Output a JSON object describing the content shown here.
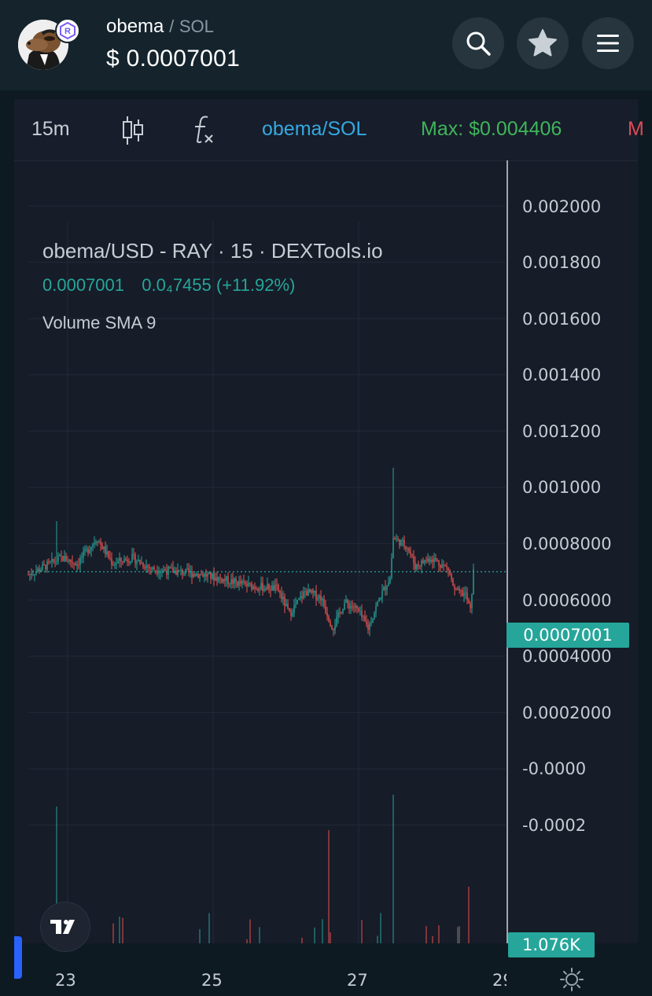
{
  "header": {
    "token_name": "obema",
    "separator": "/",
    "quote": "SOL",
    "price": "$ 0.0007001",
    "badge_letter": "R",
    "icons": [
      "search-icon",
      "star-icon",
      "menu-icon"
    ]
  },
  "toolbar": {
    "interval": "15m",
    "pair": "obema/SOL",
    "max": "Max: $0.004406",
    "cut": "M"
  },
  "chart_data": {
    "type": "candlestick",
    "title": "obema/USD - RAY · 15 · DEXTools.io",
    "last_value": "0.0007001",
    "change_value": "0.0₄7455",
    "change_pct": "(+11.92%)",
    "indicator": "Volume SMA 9",
    "y_ticks": [
      "0.002000",
      "0.001800",
      "0.001600",
      "0.001400",
      "0.001200",
      "0.001000",
      "0.0008000",
      "0.0006000",
      "0.0004000",
      "0.0002000",
      "-0.0000",
      "-0.0002"
    ],
    "x_ticks": [
      "23",
      "25",
      "27",
      "29"
    ],
    "current_price_label": "0.0007001",
    "volume_label": "1.076K",
    "ylim": [
      -0.0002,
      0.002
    ],
    "current_price": 0.0007001,
    "max_high": 0.00107,
    "colors": {
      "up": "#26a69a",
      "down": "#ef5350",
      "background": "#161c28",
      "grid": "#232a37"
    }
  }
}
